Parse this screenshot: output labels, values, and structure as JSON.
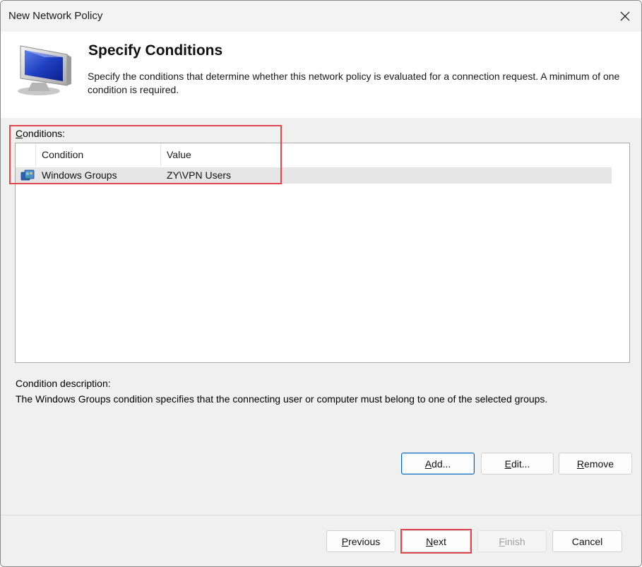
{
  "window": {
    "title": "New Network Policy"
  },
  "header": {
    "title": "Specify Conditions",
    "description": "Specify the conditions that determine whether this network policy is evaluated for a connection request. A minimum of one condition is required."
  },
  "conditions": {
    "label_prefix": "C",
    "label_rest": "onditions:",
    "columns": [
      "Condition",
      "Value"
    ],
    "rows": [
      {
        "condition": "Windows Groups",
        "value": "ZY\\VPN Users",
        "icon": "windows-groups-icon"
      }
    ]
  },
  "condition_description": {
    "title": "Condition description:",
    "text": "The Windows Groups condition specifies that the connecting user or computer must belong to one of the selected groups."
  },
  "list_buttons": {
    "add": {
      "mnemonic": "A",
      "rest": "dd..."
    },
    "edit": {
      "mnemonic": "E",
      "rest": "dit..."
    },
    "remove": {
      "mnemonic": "R",
      "rest": "emove"
    }
  },
  "footer_buttons": {
    "previous": {
      "mnemonic": "P",
      "rest": "revious"
    },
    "next": {
      "mnemonic": "N",
      "rest": "ext"
    },
    "finish": {
      "mnemonic": "F",
      "rest": "inish"
    },
    "cancel": "Cancel"
  },
  "colors": {
    "highlight": "#e0464d",
    "accent": "#0067c0",
    "selected_row": "#e6e6e6"
  }
}
